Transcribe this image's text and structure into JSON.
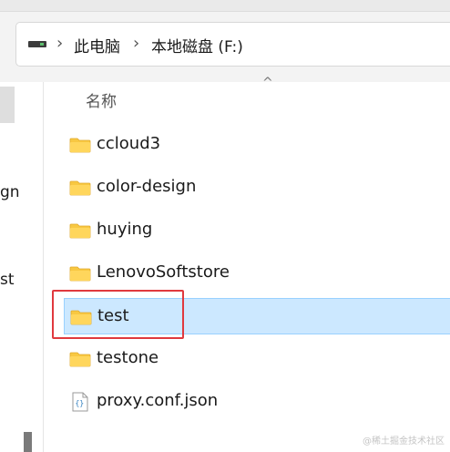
{
  "breadcrumb": {
    "items": [
      "此电脑",
      "本地磁盘 (F:)"
    ]
  },
  "nav": {
    "partial_items": [
      "gn",
      "st"
    ]
  },
  "list": {
    "header_name": "名称",
    "items": [
      {
        "name": "ccloud3",
        "type": "folder",
        "selected": false
      },
      {
        "name": "color-design",
        "type": "folder",
        "selected": false
      },
      {
        "name": "huying",
        "type": "folder",
        "selected": false
      },
      {
        "name": "LenovoSoftstore",
        "type": "folder",
        "selected": false
      },
      {
        "name": "test",
        "type": "folder",
        "selected": true
      },
      {
        "name": "testone",
        "type": "folder",
        "selected": false
      },
      {
        "name": "proxy.conf.json",
        "type": "json-file",
        "selected": false
      }
    ]
  },
  "colors": {
    "selection_bg": "#cce8ff",
    "selection_border": "#99d1ff",
    "annotation_box": "#e0393e",
    "folder": "#f8c842"
  },
  "watermark": "@稀土掘金技术社区"
}
